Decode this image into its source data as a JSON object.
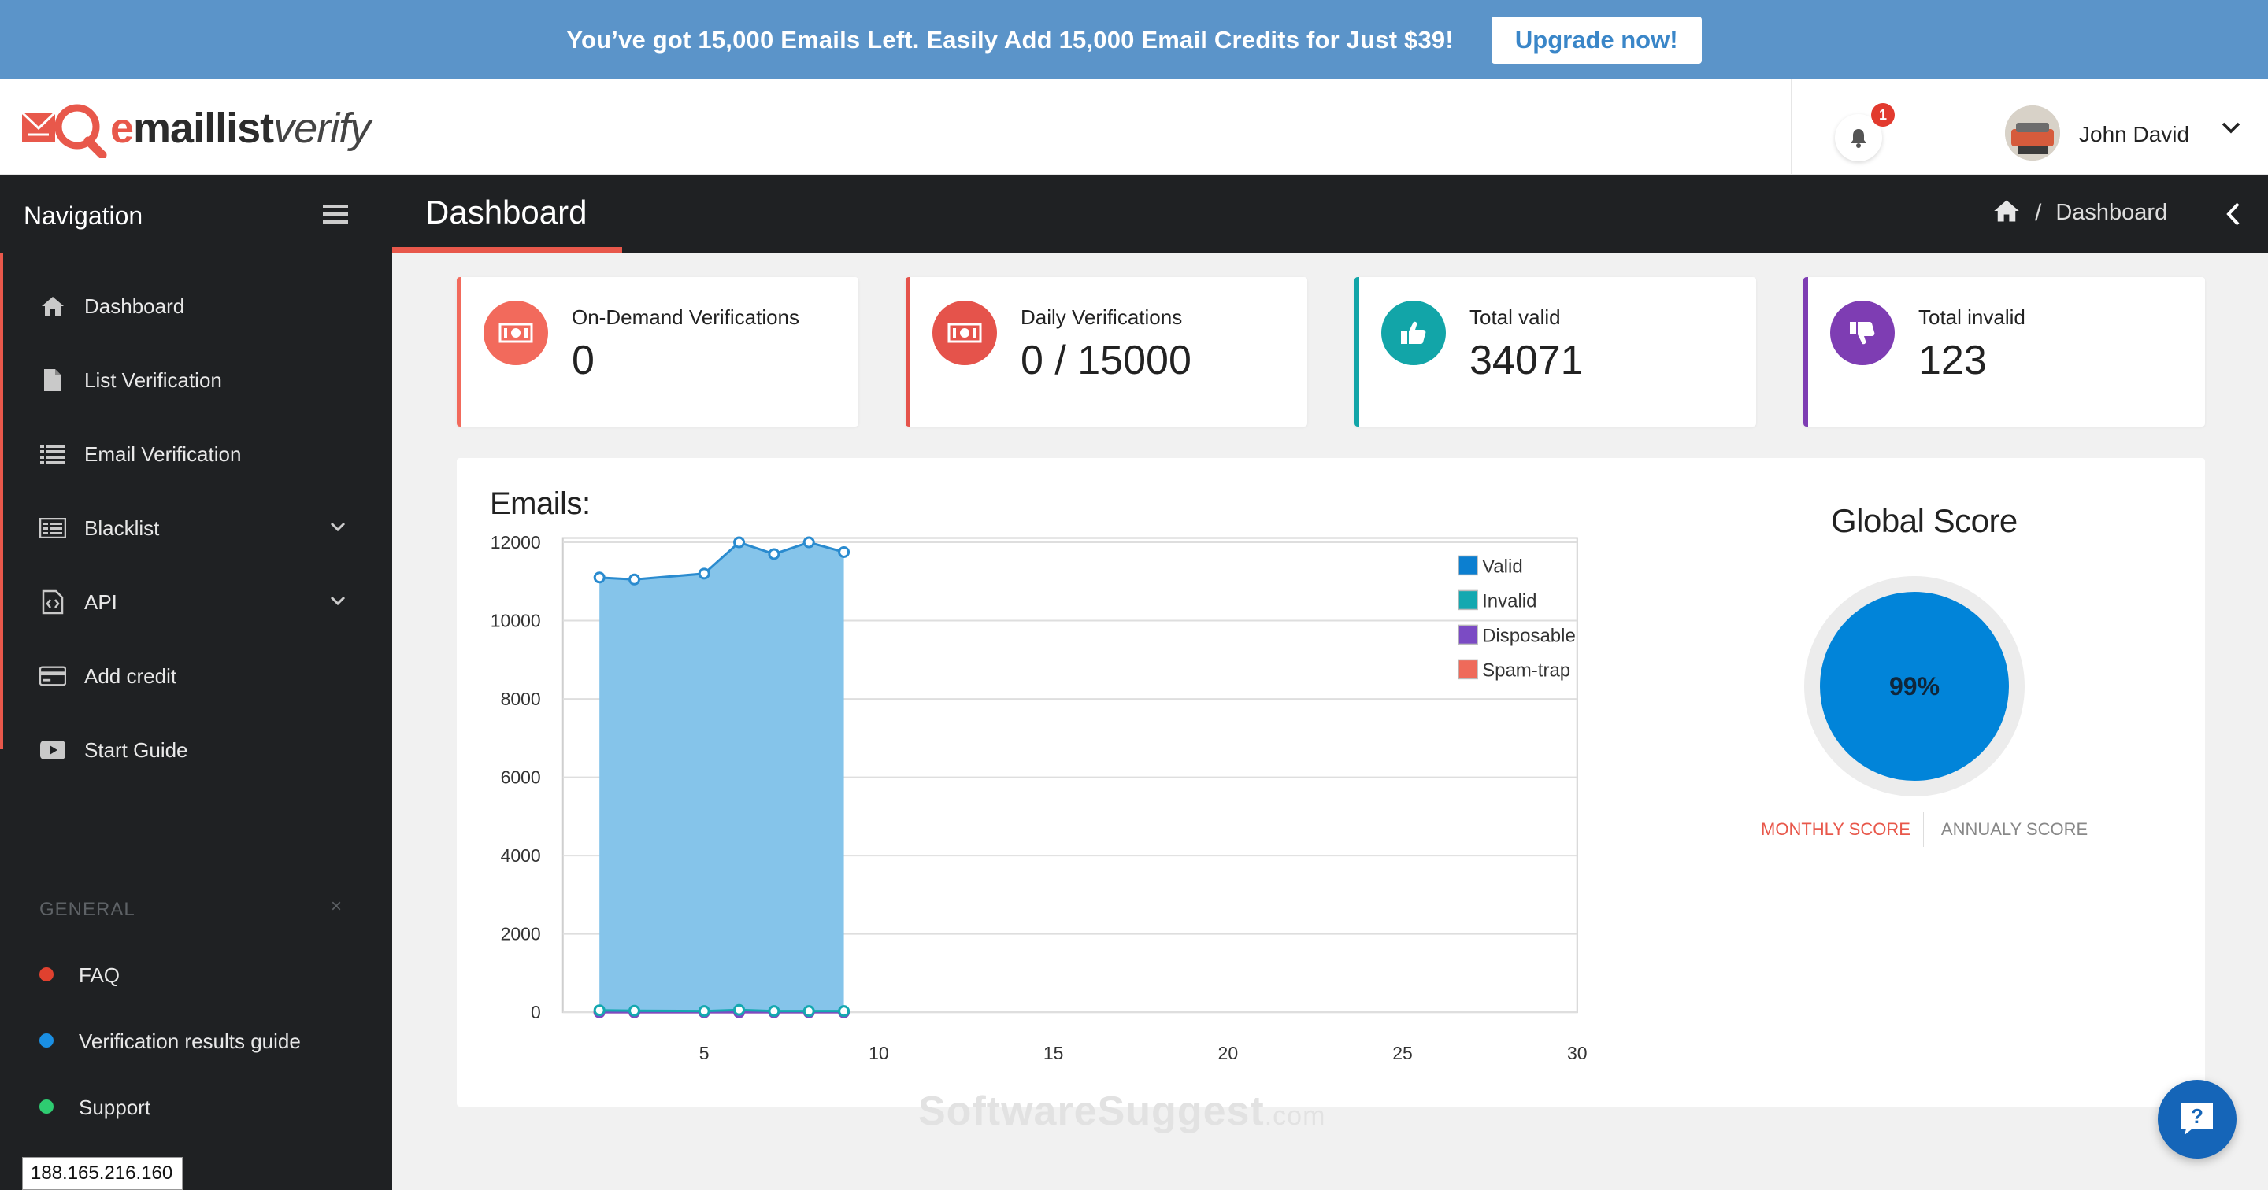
{
  "banner": {
    "message": "You’ve got 15,000 Emails Left. Easily Add 15,000 Email Credits for Just $39!",
    "upgrade_label": "Upgrade now!"
  },
  "header": {
    "logo": {
      "e": "e",
      "bold": "maillist",
      "italic": "verify"
    },
    "notification_count": "1",
    "user_name": "John David"
  },
  "sidebar": {
    "title": "Navigation",
    "items": [
      {
        "label": "Dashboard",
        "icon": "home-icon"
      },
      {
        "label": "List Verification",
        "icon": "file-icon"
      },
      {
        "label": "Email Verification",
        "icon": "list-icon"
      },
      {
        "label": "Blacklist",
        "icon": "table-icon",
        "has_submenu": true
      },
      {
        "label": "API",
        "icon": "code-file-icon",
        "has_submenu": true
      },
      {
        "label": "Add credit",
        "icon": "credit-card-icon"
      },
      {
        "label": "Start Guide",
        "icon": "play-icon"
      }
    ],
    "section_title": "GENERAL",
    "section_close": "×",
    "general_items": [
      {
        "label": "FAQ",
        "color": "#e0412f"
      },
      {
        "label": "Verification results guide",
        "color": "#1a8fe3"
      },
      {
        "label": "Support",
        "color": "#2ecc71"
      }
    ],
    "ip_address": "188.165.216.160"
  },
  "titlebar": {
    "title": "Dashboard",
    "breadcrumb_sep": "/",
    "breadcrumb": "Dashboard"
  },
  "cards": [
    {
      "label": "On-Demand Verifications",
      "value": "0",
      "color": "#f26a5c",
      "icon": "money-icon"
    },
    {
      "label": "Daily Verifications",
      "value": "0 / 15000",
      "color": "#e5534b",
      "icon": "money-icon"
    },
    {
      "label": "Total valid",
      "value": "34071",
      "color": "#12a5a8",
      "icon": "thumbs-up-icon"
    },
    {
      "label": "Total invalid",
      "value": "123",
      "color": "#7e3db3",
      "icon": "thumbs-down-icon"
    }
  ],
  "chart_data": {
    "type": "area",
    "title": "Emails:",
    "xlabel": "",
    "ylabel": "",
    "xlim": [
      0,
      30
    ],
    "ylim": [
      0,
      12000
    ],
    "x_ticks": [
      5,
      10,
      15,
      20,
      25,
      30
    ],
    "y_ticks": [
      0,
      2000,
      4000,
      6000,
      8000,
      10000,
      12000
    ],
    "grid": true,
    "legend_position": "top-right",
    "series": [
      {
        "name": "Valid",
        "color": "#0c7fd0",
        "x": [
          2,
          3,
          5,
          6,
          7,
          8,
          9
        ],
        "values": [
          11100,
          11050,
          11200,
          12000,
          11700,
          12000,
          11750
        ]
      },
      {
        "name": "Invalid",
        "color": "#14a8b0",
        "x": [
          2,
          3,
          5,
          6,
          7,
          8,
          9
        ],
        "values": [
          50,
          40,
          30,
          60,
          30,
          30,
          30
        ]
      },
      {
        "name": "Disposable",
        "color": "#7b4bc4",
        "x": [
          2,
          3,
          5,
          6,
          7,
          8,
          9
        ],
        "values": [
          0,
          0,
          0,
          0,
          0,
          0,
          0
        ]
      },
      {
        "name": "Spam-trap",
        "color": "#ef6a5a",
        "x": [
          2,
          3,
          5,
          6,
          7,
          8,
          9
        ],
        "values": [
          0,
          0,
          0,
          0,
          0,
          0,
          0
        ]
      }
    ]
  },
  "global_score": {
    "title": "Global Score",
    "value": "99%",
    "fraction": 0.99,
    "tab_monthly": "MONTHLY SCORE",
    "tab_annual": "ANNUALY SCORE"
  },
  "watermark": {
    "main": "SoftwareSuggest",
    "suffix": ".com"
  }
}
